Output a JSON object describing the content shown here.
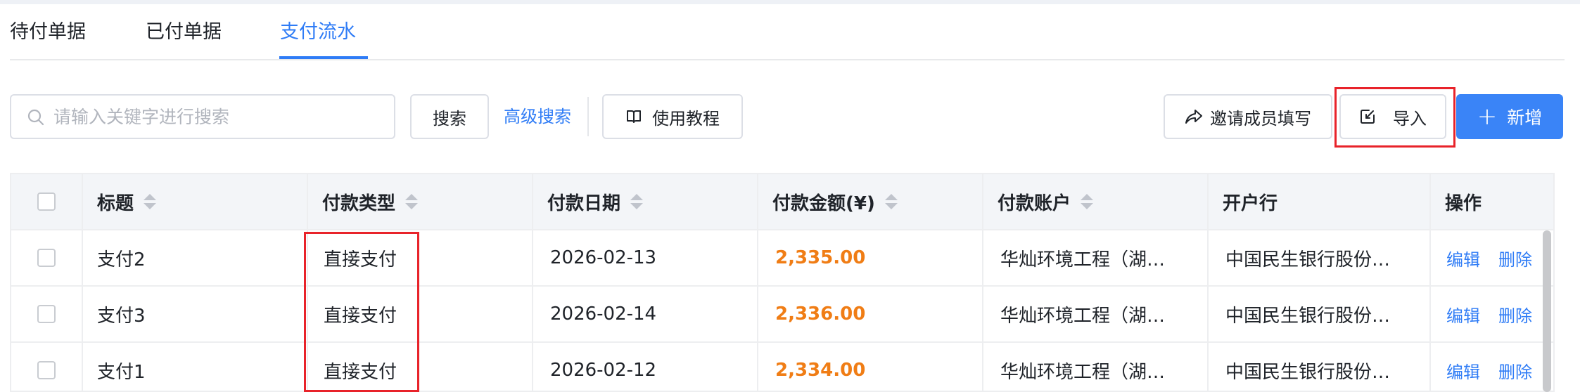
{
  "tabs": [
    {
      "label": "待付单据",
      "active": false
    },
    {
      "label": "已付单据",
      "active": false
    },
    {
      "label": "支付流水",
      "active": true
    }
  ],
  "toolbar": {
    "search_placeholder": "请输入关键字进行搜索",
    "search_label": "搜索",
    "advanced_search_label": "高级搜索",
    "tutorial_label": "使用教程",
    "invite_label": "邀请成员填写",
    "import_label": "导入",
    "new_label": "新增"
  },
  "table": {
    "headers": {
      "title": "标题",
      "pay_type": "付款类型",
      "pay_date": "付款日期",
      "amount": "付款金额(¥)",
      "account": "付款账户",
      "bank": "开户行",
      "actions": "操作"
    },
    "rows": [
      {
        "title": "支付2",
        "pay_type": "直接支付",
        "pay_date": "2026-02-13",
        "amount": "2,335.00",
        "account": "华灿环境工程（湖…",
        "bank": "中国民生银行股份…",
        "edit": "编辑",
        "delete": "删除"
      },
      {
        "title": "支付3",
        "pay_type": "直接支付",
        "pay_date": "2026-02-14",
        "amount": "2,336.00",
        "account": "华灿环境工程（湖…",
        "bank": "中国民生银行股份…",
        "edit": "编辑",
        "delete": "删除"
      },
      {
        "title": "支付1",
        "pay_type": "直接支付",
        "pay_date": "2026-02-12",
        "amount": "2,334.00",
        "account": "华灿环境工程（湖…",
        "bank": "中国民生银行股份…",
        "edit": "编辑",
        "delete": "删除"
      }
    ]
  },
  "colors": {
    "accent": "#2f7cf6",
    "amount": "#f07d15",
    "highlight": "#e8232a"
  },
  "icons": [
    "search-icon",
    "book-icon",
    "share-icon",
    "import-icon",
    "plus-icon",
    "sort-icon"
  ]
}
